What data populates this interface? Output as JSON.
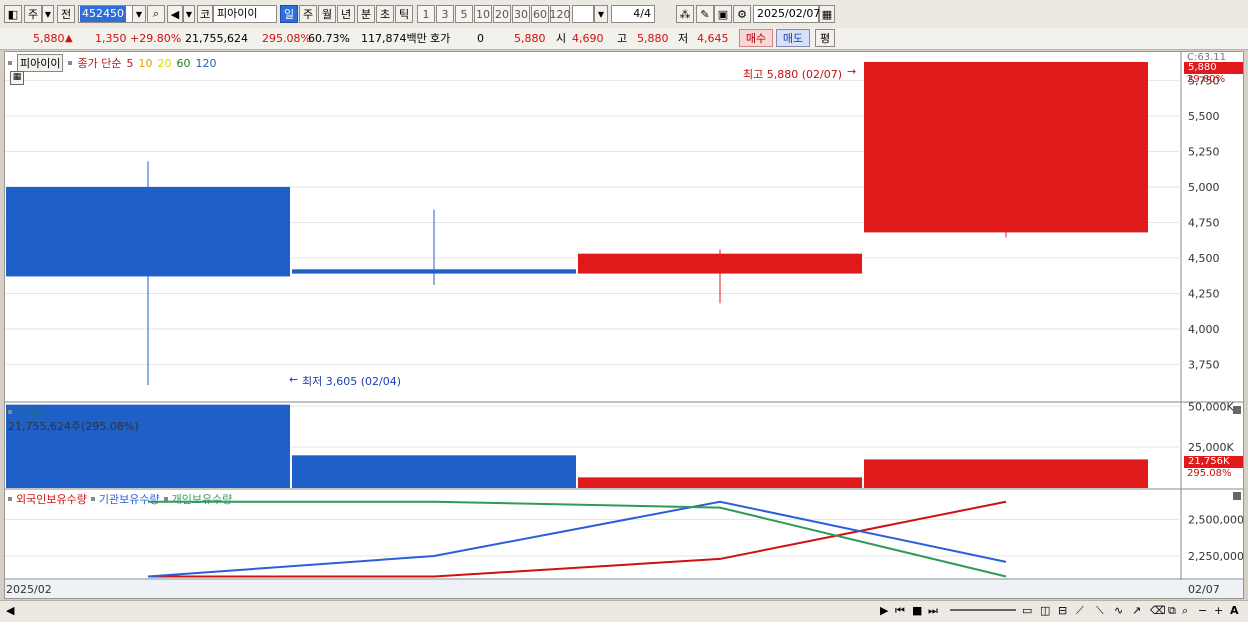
{
  "toolbar": {
    "type1": "주",
    "type2": "전",
    "code": "452450",
    "name_prefix": "코",
    "name": "피아이이",
    "periods": [
      "일",
      "주",
      "월",
      "년",
      "분",
      "초",
      "틱"
    ],
    "active_period": "일",
    "nums": [
      "1",
      "3",
      "5",
      "10",
      "20",
      "30",
      "60",
      "120"
    ],
    "page": "4/4",
    "date": "2025/02/07"
  },
  "quote": {
    "price": "5,880",
    "change": "1,350",
    "change_pct": "+29.80%",
    "volume": "21,755,624",
    "volume_pct": "295.08%",
    "turnover_pct": "60.73%",
    "amount": "117,874백만",
    "hoga_label": "호가",
    "hoga": "0",
    "hoga_price": "5,880",
    "open_label": "시",
    "open": "4,690",
    "high_label": "고",
    "high": "5,880",
    "low_label": "저",
    "low": "4,645",
    "buy": "매수",
    "sell": "매도",
    "avg": "평"
  },
  "legend": {
    "name": "피아이이",
    "ma_prefix": "종가 단순",
    "ma": [
      {
        "label": "5",
        "color": "#c01010"
      },
      {
        "label": "10",
        "color": "#e0a000"
      },
      {
        "label": "20",
        "color": "#d8d800"
      },
      {
        "label": "60",
        "color": "#208020"
      },
      {
        "label": "120",
        "color": "#2060c0"
      }
    ]
  },
  "annotations": {
    "high": "최고 5,880 (02/07)",
    "low": "최저 3,605 (02/04)",
    "right_cg": "C:63.11",
    "right_price": "5,880",
    "right_pct": "29.80%"
  },
  "volume_panel": {
    "title": "거래량",
    "readout": "21,755,624주(295.08%)",
    "right_val": "21,756K",
    "right_pct": "295.08%",
    "ticks": [
      "50,000K",
      "25,000K"
    ]
  },
  "holdings_panel": {
    "series": [
      {
        "name": "외국인보유수량",
        "color": "#d01010"
      },
      {
        "name": "기관보유수량",
        "color": "#2a5fd8"
      },
      {
        "name": "개인보유수량",
        "color": "#2f9a5a"
      }
    ],
    "ticks": [
      "2,500,000",
      "2,250,000"
    ]
  },
  "xaxis": {
    "left": "2025/02",
    "right": "02/07"
  },
  "chart_data": [
    {
      "type": "candlestick",
      "ylim": [
        3500,
        5950
      ],
      "yticks": [
        5750,
        5500,
        5250,
        5000,
        4750,
        4500,
        4250,
        4000,
        3750
      ],
      "candles": [
        {
          "open": 5000,
          "close": 4370,
          "high": 5180,
          "low": 3605,
          "color": "#1f5fc8"
        },
        {
          "open": 4420,
          "close": 4390,
          "high": 4840,
          "low": 4310,
          "color": "#1f5fc8"
        },
        {
          "open": 4390,
          "close": 4530,
          "high": 4560,
          "low": 4180,
          "color": "#e01a1a"
        },
        {
          "open": 4680,
          "close": 5880,
          "high": 5880,
          "low": 4645,
          "color": "#e01a1a"
        }
      ]
    },
    {
      "type": "bar",
      "ylim": [
        0,
        52000
      ],
      "values": [
        51000,
        20000,
        6500,
        17500
      ],
      "colors": [
        "#1f5fc8",
        "#1f5fc8",
        "#e01a1a",
        "#e01a1a"
      ]
    },
    {
      "type": "line",
      "ylim": [
        2100000,
        2700000
      ],
      "series": [
        {
          "name": "외국인보유수량",
          "values": [
            2110000,
            2110000,
            2230000,
            2620000
          ],
          "color": "#d01010"
        },
        {
          "name": "기관보유수량",
          "values": [
            2110000,
            2250000,
            2620000,
            2210000
          ],
          "color": "#2a5fd8"
        },
        {
          "name": "개인보유수량",
          "values": [
            2620000,
            2620000,
            2580000,
            2110000
          ],
          "color": "#2f9a5a"
        }
      ]
    }
  ]
}
